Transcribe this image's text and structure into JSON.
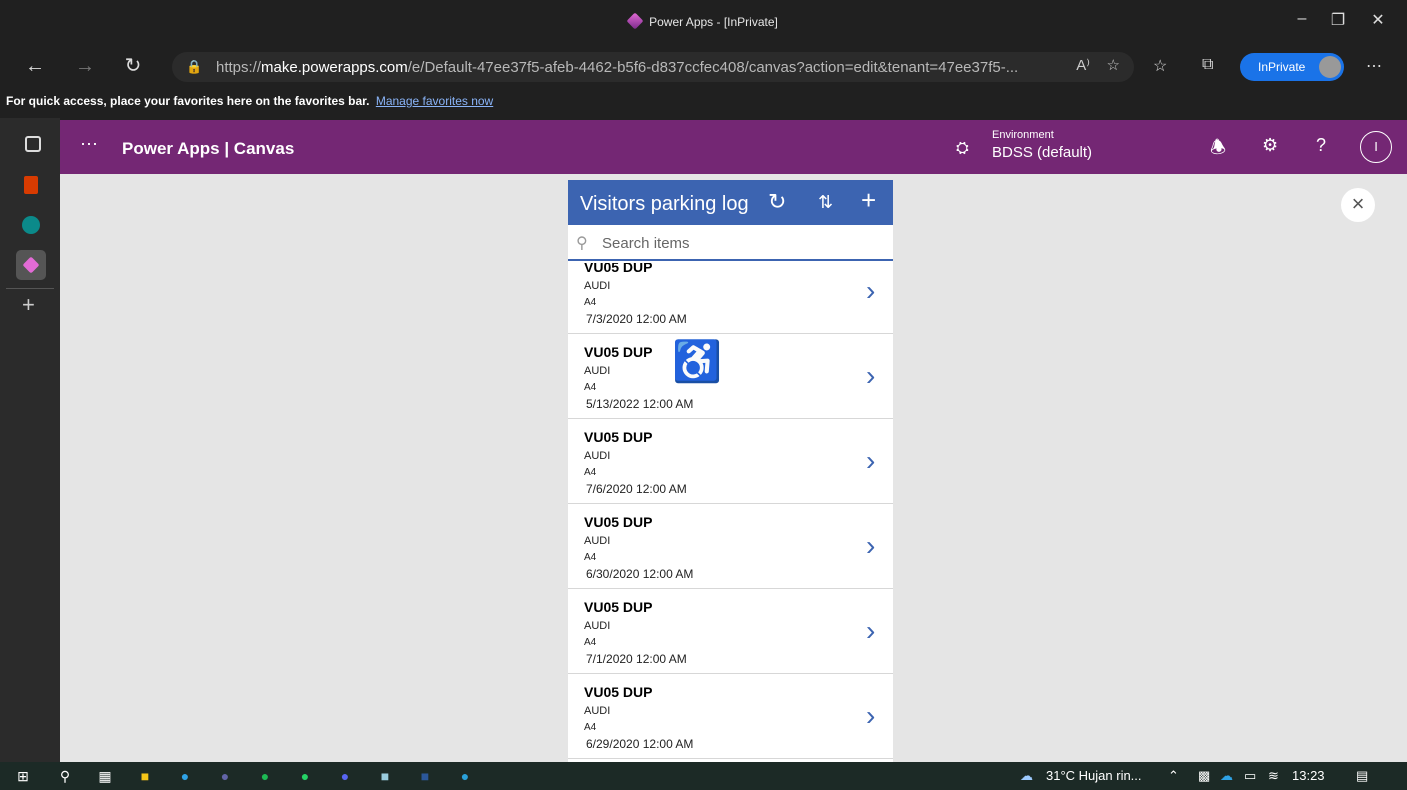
{
  "browser": {
    "window_title": "Power Apps - [InPrivate]",
    "url_prefix": "https://",
    "url_host": "make.powerapps.com",
    "url_rest": "/e/Default-47ee37f5-afeb-4462-b5f6-d837ccfec408/canvas?action=edit&tenant=47ee37f5-...",
    "inprivate_label": "InPrivate",
    "favorites_text": "For quick access, place your favorites here on the favorites bar.",
    "favorites_link": "Manage favorites now"
  },
  "powerapps": {
    "brand": "Power Apps  |  Canvas",
    "environment_label": "Environment",
    "environment_value": "BDSS (default)",
    "user_initial": "I"
  },
  "app": {
    "title": "Visitors parking log",
    "search_placeholder": "Search items",
    "items": [
      {
        "plate": "VU05 DUP",
        "make": "AUDI",
        "model": "A4",
        "date": "7/3/2020 12:00 AM"
      },
      {
        "plate": "VU05 DUP",
        "make": "AUDI",
        "model": "A4",
        "date": "5/13/2022 12:00 AM"
      },
      {
        "plate": "VU05 DUP",
        "make": "AUDI",
        "model": "A4",
        "date": "7/6/2020 12:00 AM"
      },
      {
        "plate": "VU05 DUP",
        "make": "AUDI",
        "model": "A4",
        "date": "6/30/2020 12:00 AM"
      },
      {
        "plate": "VU05 DUP",
        "make": "AUDI",
        "model": "A4",
        "date": "7/1/2020 12:00 AM"
      },
      {
        "plate": "VU05 DUP",
        "make": "AUDI",
        "model": "A4",
        "date": "6/29/2020 12:00 AM"
      }
    ]
  },
  "taskbar": {
    "weather": "31°C  Hujan rin...",
    "time": "13:23"
  },
  "colors": {
    "powerapps_purple": "#742774",
    "app_header_blue": "#3c64b1",
    "canvas_gray": "#e5e5e5"
  }
}
